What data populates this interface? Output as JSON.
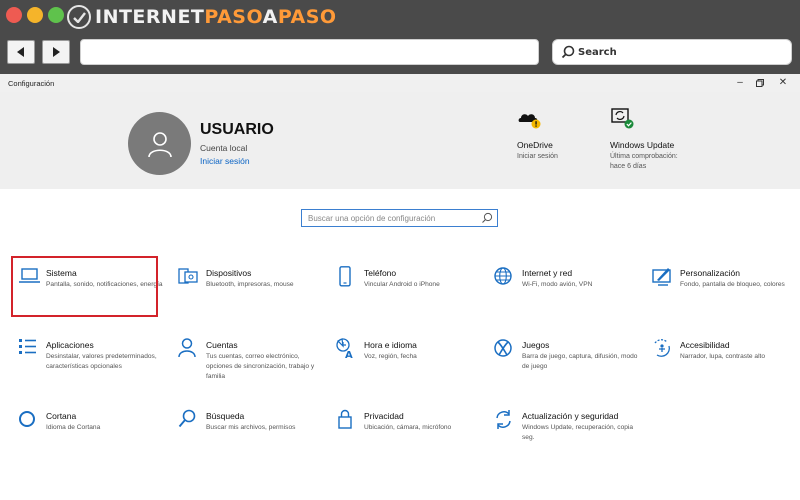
{
  "browser": {
    "brand_prefix": "INTERNET",
    "brand_accent": "PASO",
    "brand_mid": "A",
    "brand_suffix": "PASO",
    "search_label": "Search",
    "url_value": ""
  },
  "window": {
    "title": "Configuración"
  },
  "account": {
    "name": "USUARIO",
    "type": "Cuenta local",
    "signin_link": "Iniciar sesión"
  },
  "header_items": [
    {
      "title": "OneDrive",
      "subtitle": "Iniciar sesión"
    },
    {
      "title": "Windows Update",
      "subtitle": "Última comprobación: hace 6 días"
    }
  ],
  "search": {
    "placeholder": "Buscar una opción de configuración"
  },
  "categories": [
    {
      "title": "Sistema",
      "desc": "Pantalla, sonido, notificaciones, energía",
      "icon": "laptop-icon"
    },
    {
      "title": "Dispositivos",
      "desc": "Bluetooth, impresoras, mouse",
      "icon": "devices-icon"
    },
    {
      "title": "Teléfono",
      "desc": "Vincular Android o iPhone",
      "icon": "phone-icon"
    },
    {
      "title": "Internet y red",
      "desc": "Wi-Fi, modo avión, VPN",
      "icon": "globe-icon"
    },
    {
      "title": "Personalización",
      "desc": "Fondo, pantalla de bloqueo, colores",
      "icon": "paint-icon"
    },
    {
      "title": "Aplicaciones",
      "desc": "Desinstalar, valores predeterminados, características opcionales",
      "icon": "apps-list-icon"
    },
    {
      "title": "Cuentas",
      "desc": "Tus cuentas, correo electrónico, opciones de sincronización, trabajo y familia",
      "icon": "person-icon"
    },
    {
      "title": "Hora e idioma",
      "desc": "Voz, región, fecha",
      "icon": "time-language-icon"
    },
    {
      "title": "Juegos",
      "desc": "Barra de juego, captura, difusión, modo de juego",
      "icon": "xbox-icon"
    },
    {
      "title": "Accesibilidad",
      "desc": "Narrador, lupa, contraste alto",
      "icon": "accessibility-icon"
    },
    {
      "title": "Cortana",
      "desc": "Idioma de Cortana",
      "icon": "cortana-icon"
    },
    {
      "title": "Búsqueda",
      "desc": "Buscar mis archivos, permisos",
      "icon": "search-icon"
    },
    {
      "title": "Privacidad",
      "desc": "Ubicación, cámara, micrófono",
      "icon": "lock-icon"
    },
    {
      "title": "Actualización y seguridad",
      "desc": "Windows Update, recuperación, copia seg.",
      "icon": "sync-icon"
    }
  ],
  "colors": {
    "accent": "#0a63c4",
    "icon_blue": "#1a6ec2",
    "highlight_red": "#d3232a"
  }
}
